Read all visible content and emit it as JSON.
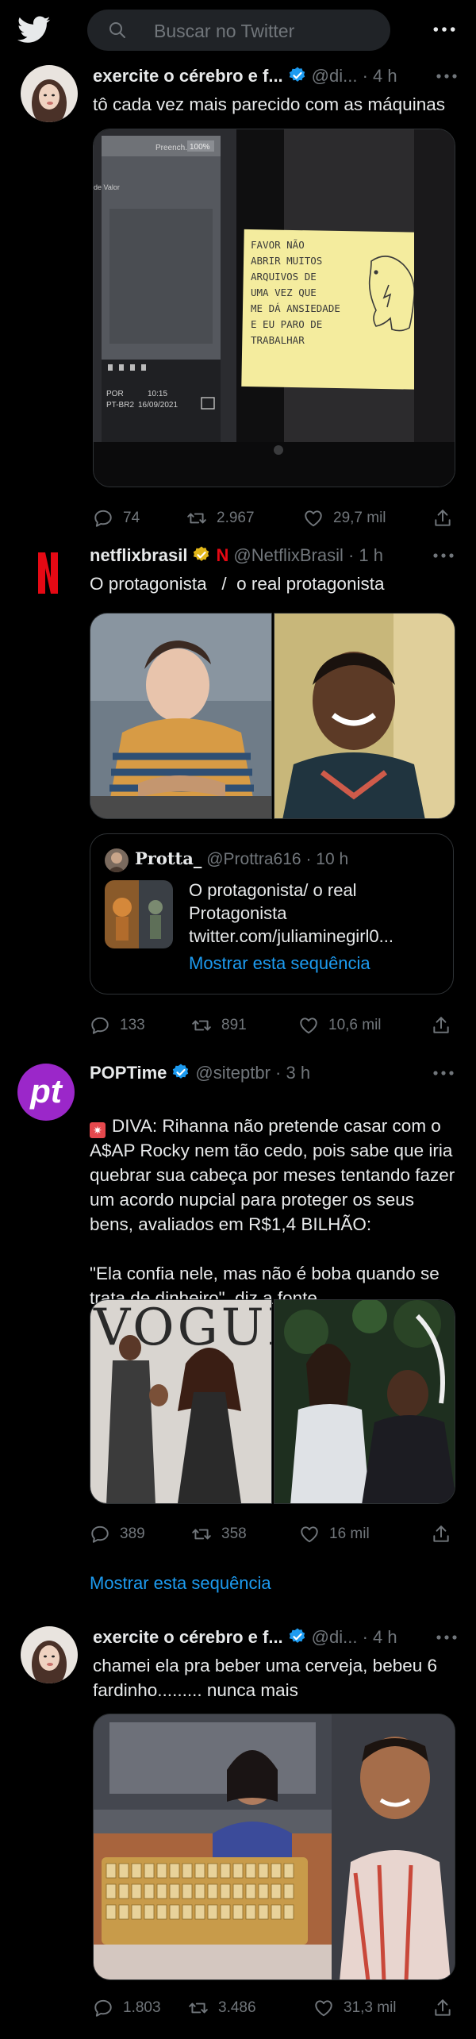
{
  "search": {
    "placeholder": "Buscar no Twitter"
  },
  "icons": {
    "app": "twitter-bird-icon",
    "search": "search-icon",
    "more": "more-icon",
    "verified": "verified-badge-icon",
    "reply": "reply-icon",
    "retweet": "retweet-icon",
    "like": "like-icon",
    "share": "share-icon"
  },
  "colors": {
    "background": "#000000",
    "accent": "#1d9bf0",
    "muted": "#71767b",
    "verified_gold": "#e2b719",
    "netflix_red": "#e50914",
    "poptime_purple": "#9b27c9"
  },
  "tweets": [
    {
      "name": "exercite o cérebro e f...",
      "handle": "@di...",
      "time": "· 4 h",
      "text": "tô cada vez mais parecido com as máquinas",
      "media_text": {
        "note": "FAVOR NÃO ABRIR MUITOS ARQUIVOS DE UMA VEZ QUE ME DÁ ANSIEDADE E EU PARO DE TRABALHAR",
        "zoom": "100%",
        "pt": "PT-BR2",
        "port": "POR",
        "clock": "10:15",
        "date": "16/09/2021",
        "panel_label": "Preench.",
        "panel_value": "de Valor"
      },
      "replies": "74",
      "retweets": "2.967",
      "likes": "29,7 mil"
    },
    {
      "name": "netflixbrasil",
      "handle": "@NetflixBrasil",
      "time": "· 1 h",
      "text": "O protagonista   /  o real protagonista",
      "quote": {
        "name": "Protta_",
        "handle": "@Prottra616",
        "time": "· 10 h",
        "text": "O protagonista/ o real Protagonista",
        "link": "twitter.com/juliaminegirl0...",
        "show": "Mostrar esta sequência"
      },
      "replies": "133",
      "retweets": "891",
      "likes": "10,6 mil"
    },
    {
      "name": "POPTime",
      "handle": "@siteptbr",
      "time": "· 3 h",
      "avatar_text": "pt",
      "text": "DIVA: Rihanna não pretende casar com o A$AP Rocky nem tão cedo, pois sabe que iria quebrar sua cabeça por meses tentando fazer um acordo nupcial para proteger os seus bens, avaliados em R$1,4 BILHÃO:\n\n\"Ela confia nele, mas não é boba quando se trata de dinheiro\", diz a fonte.",
      "media_text": {
        "magazine": "VOGUE"
      },
      "replies": "389",
      "retweets": "358",
      "likes": "16 mil",
      "show": "Mostrar esta sequência"
    },
    {
      "name": "exercite o cérebro e f...",
      "handle": "@di...",
      "time": "· 4 h",
      "text": "chamei ela pra beber uma cerveja, bebeu 6 fardinho......... nunca mais",
      "replies": "1.803",
      "retweets": "3.486",
      "likes": "31,3 mil"
    }
  ]
}
